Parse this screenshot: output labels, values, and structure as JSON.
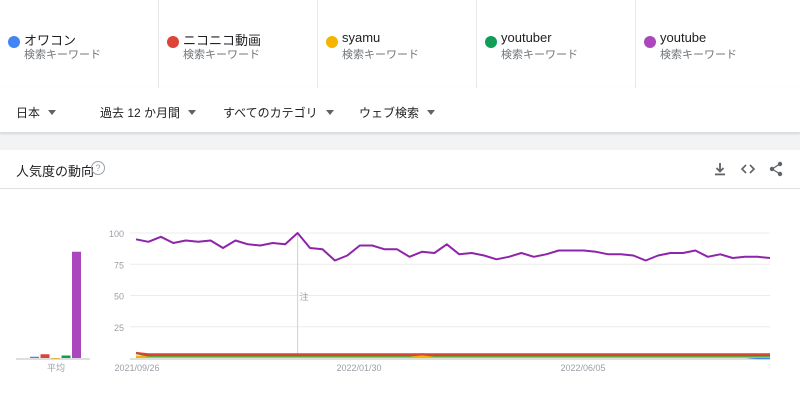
{
  "terms": [
    {
      "name": "オワコン",
      "sub": "検索キーワード",
      "color": "#4285f4"
    },
    {
      "name": "ニコニコ動画",
      "sub": "検索キーワード",
      "color": "#db4437"
    },
    {
      "name": "syamu",
      "sub": "検索キーワード",
      "color": "#f4b400"
    },
    {
      "name": "youtuber",
      "sub": "検索キーワード",
      "color": "#0f9d58"
    },
    {
      "name": "youtube",
      "sub": "検索キーワード",
      "color": "#ab47bc"
    }
  ],
  "filters": {
    "region": "日本",
    "period": "過去 12 か月間",
    "category": "すべてのカテゴリ",
    "search_type": "ウェブ検索"
  },
  "card": {
    "title": "人気度の動向",
    "help": "?",
    "icons": [
      "download-icon",
      "embed-icon",
      "share-icon"
    ]
  },
  "chart_data": {
    "type": "line",
    "title": "",
    "y_ticks": [
      "100",
      "75",
      "50",
      "25"
    ],
    "x_labels": [
      "2021/09/26",
      "2022/01/30",
      "2022/06/05"
    ],
    "ylim": [
      0,
      100
    ],
    "annotation": "注",
    "average_label": "平均",
    "averages": [
      {
        "name": "オワコン",
        "value": 1,
        "color": "#4285f4"
      },
      {
        "name": "ニコニコ動画",
        "value": 3,
        "color": "#db4437"
      },
      {
        "name": "syamu",
        "value": 0,
        "color": "#f4b400"
      },
      {
        "name": "youtuber",
        "value": 2,
        "color": "#0f9d58"
      },
      {
        "name": "youtube",
        "value": 85,
        "color": "#ab47bc"
      }
    ],
    "series": [
      {
        "name": "youtube",
        "color": "#8e24aa",
        "values": [
          95,
          93,
          97,
          92,
          94,
          93,
          94,
          88,
          94,
          91,
          90,
          92,
          91,
          100,
          88,
          87,
          78,
          82,
          90,
          90,
          87,
          87,
          81,
          85,
          84,
          91,
          83,
          84,
          82,
          79,
          81,
          84,
          81,
          83,
          86,
          86,
          86,
          85,
          83,
          83,
          82,
          78,
          82,
          84,
          84,
          86,
          81,
          83,
          80,
          81,
          81,
          80
        ]
      },
      {
        "name": "ニコニコ動画",
        "color": "#db4437",
        "values": [
          4,
          3,
          3,
          3,
          3,
          3,
          3,
          3,
          3,
          3,
          3,
          3,
          3,
          3,
          3,
          3,
          3,
          3,
          3,
          3,
          3,
          3,
          3,
          3,
          3,
          3,
          3,
          3,
          3,
          3,
          3,
          3,
          3,
          3,
          3,
          3,
          3,
          3,
          3,
          3,
          3,
          3,
          3,
          3,
          3,
          3,
          3,
          3,
          3,
          3,
          3,
          3
        ]
      },
      {
        "name": "youtuber",
        "color": "#0f9d58",
        "values": [
          4,
          2,
          2,
          2,
          2,
          2,
          2,
          2,
          2,
          2,
          2,
          2,
          2,
          2,
          2,
          2,
          2,
          2,
          2,
          2,
          2,
          2,
          2,
          3,
          2,
          2,
          2,
          2,
          2,
          2,
          2,
          2,
          2,
          2,
          2,
          2,
          2,
          2,
          2,
          2,
          2,
          2,
          2,
          2,
          2,
          2,
          2,
          2,
          2,
          2,
          2,
          2
        ]
      },
      {
        "name": "syamu",
        "color": "#f4b400",
        "values": [
          1,
          1,
          1,
          1,
          1,
          1,
          1,
          1,
          1,
          1,
          1,
          1,
          1,
          1,
          1,
          1,
          1,
          1,
          1,
          1,
          1,
          1,
          1,
          1,
          1,
          1,
          1,
          1,
          1,
          1,
          1,
          1,
          1,
          1,
          1,
          1,
          1,
          1,
          1,
          1,
          1,
          1,
          1,
          1,
          1,
          1,
          1,
          1,
          1,
          1,
          1,
          1
        ]
      },
      {
        "name": "オワコン",
        "color": "#4285f4",
        "values": [
          1,
          1,
          1,
          1,
          1,
          1,
          1,
          1,
          1,
          1,
          1,
          1,
          1,
          1,
          1,
          1,
          1,
          1,
          1,
          1,
          1,
          1,
          1,
          1,
          1,
          1,
          1,
          1,
          1,
          1,
          1,
          1,
          1,
          1,
          1,
          1,
          1,
          1,
          1,
          1,
          1,
          1,
          1,
          1,
          1,
          1,
          1,
          1,
          1,
          1,
          0,
          0
        ]
      }
    ]
  }
}
